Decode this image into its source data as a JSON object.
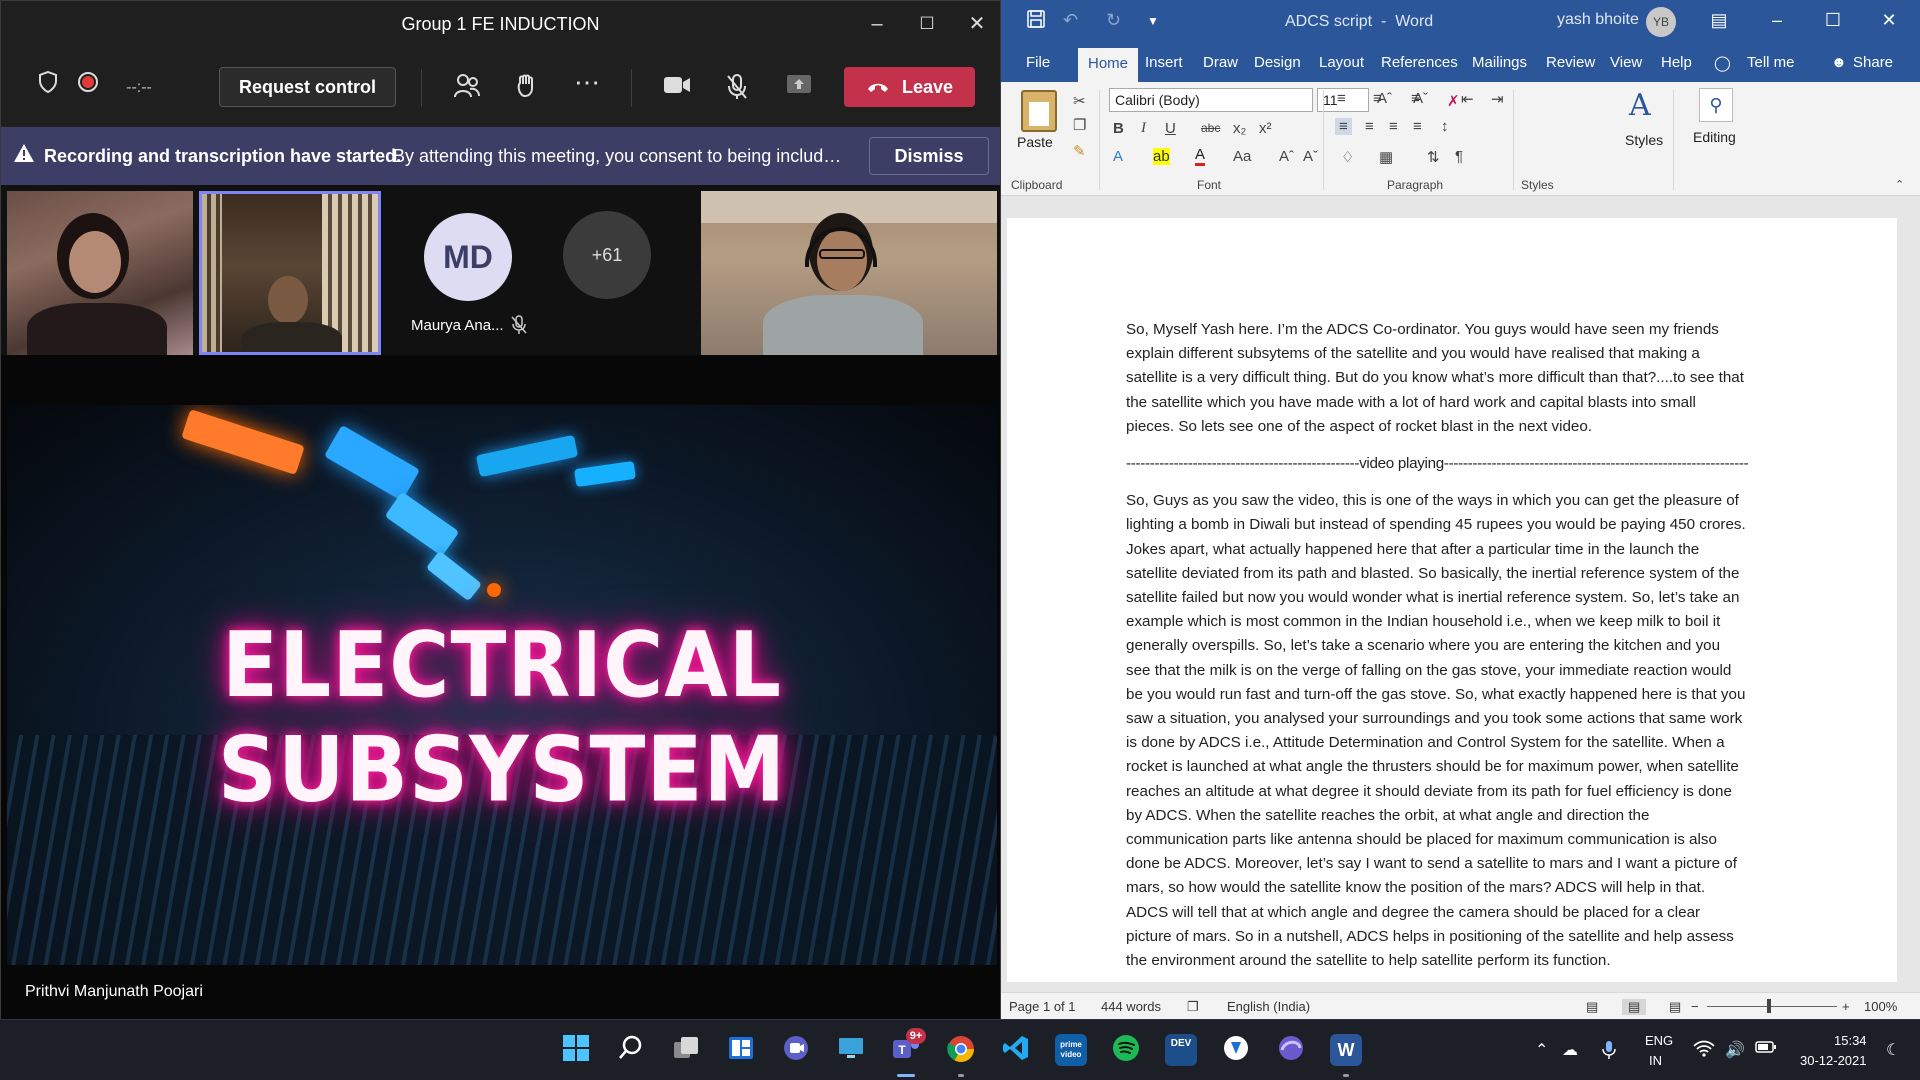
{
  "teams": {
    "window_title": "Group 1 FE INDUCTION",
    "timer": "--:--",
    "request_control": "Request control",
    "leave": "Leave",
    "banner": {
      "bold": "Recording and transcription have started.",
      "text": "By attending this meeting, you consent to being include...",
      "dismiss": "Dismiss"
    },
    "participants": {
      "avatar_initials": "MD",
      "avatar_name": "Maurya Ana...",
      "overflow_count": "+61"
    },
    "share": {
      "headline": "ELECTRICAL SUBSYSTEM",
      "presenter": "Prithvi Manjunath Poojari"
    },
    "colors": {
      "leave": "#c4314b",
      "banner": "#3d3e66",
      "active_tile_border": "#7f85f5"
    }
  },
  "word": {
    "title": "ADCS script",
    "separator": "-",
    "app": "Word",
    "user": "yash bhoite",
    "user_initials": "YB",
    "tabs": [
      "File",
      "Home",
      "Insert",
      "Draw",
      "Design",
      "Layout",
      "References",
      "Mailings",
      "Review",
      "View",
      "Help"
    ],
    "tell_me": "Tell me",
    "share": "Share",
    "ribbon": {
      "paste": "Paste",
      "font_name": "Calibri (Body)",
      "font_size": "11",
      "styles": "Styles",
      "editing": "Editing",
      "groups": {
        "clipboard": "Clipboard",
        "font": "Font",
        "paragraph": "Paragraph",
        "styles": "Styles"
      }
    },
    "document": {
      "paragraphs": [
        "So, Myself Yash here. I’m the ADCS Co-ordinator. You guys would have seen my friends explain different subsytems of the satellite and you would have realised that making a satellite is a very difficult thing. But do you know what’s more difficult than that?....to see that the satellite which you have made with a lot of hard work and capital blasts into small pieces. So lets see one of the aspect of rocket blast in the next video.",
        "-------------------------------------------------video playing------------------------------------------------------------------",
        "So, Guys as you saw the video, this is one of the ways in which you can get the pleasure of lighting a bomb in Diwali but instead of spending 45 rupees you would be paying 450 crores. Jokes apart, what actually happened here that after a particular time in the launch the satellite deviated from its path and blasted. So basically, the inertial reference system of the satellite failed but now you would wonder what is inertial reference system. So, let’s take an example which is most common in the Indian household i.e., when we keep milk to boil it generally overspills. So, let’s take a scenario where you are entering the kitchen and you see that the milk is on the verge of falling on the gas stove, your immediate reaction would be you would run fast and turn-off the gas stove. So, what exactly happened here is that you saw a situation, you analysed your surroundings and you took some actions that same work is done by ADCS i.e., Attitude Determination and Control System for the satellite. When a rocket is launched at what angle the thrusters should be for maximum power, when satellite reaches an altitude at what degree it should deviate from its path for fuel efficiency is done by ADCS. When the satellite reaches the orbit, at what angle and direction the communication parts like antenna should be placed for maximum communication is also done be ADCS. Moreover, let’s say I want to send a satellite to mars and I want a picture of mars, so how would the satellite know the position of the mars? ADCS will help in that. ADCS will tell that at which angle and degree the camera should be placed for a clear picture of mars. So in a nutshell, ADCS helps in positioning of the satellite and help assess the environment around the satellite to help satellite perform its function."
      ]
    },
    "status": {
      "page": "Page 1 of 1",
      "words": "444 words",
      "language": "English (India)",
      "zoom": "100%",
      "zoom_minus": "−",
      "zoom_plus": "+"
    },
    "colors": {
      "brand": "#2b579a"
    }
  },
  "taskbar": {
    "teams_badge": "9+",
    "lang_1": "ENG",
    "lang_2": "IN",
    "time": "15:34",
    "date": "30-12-2021"
  }
}
